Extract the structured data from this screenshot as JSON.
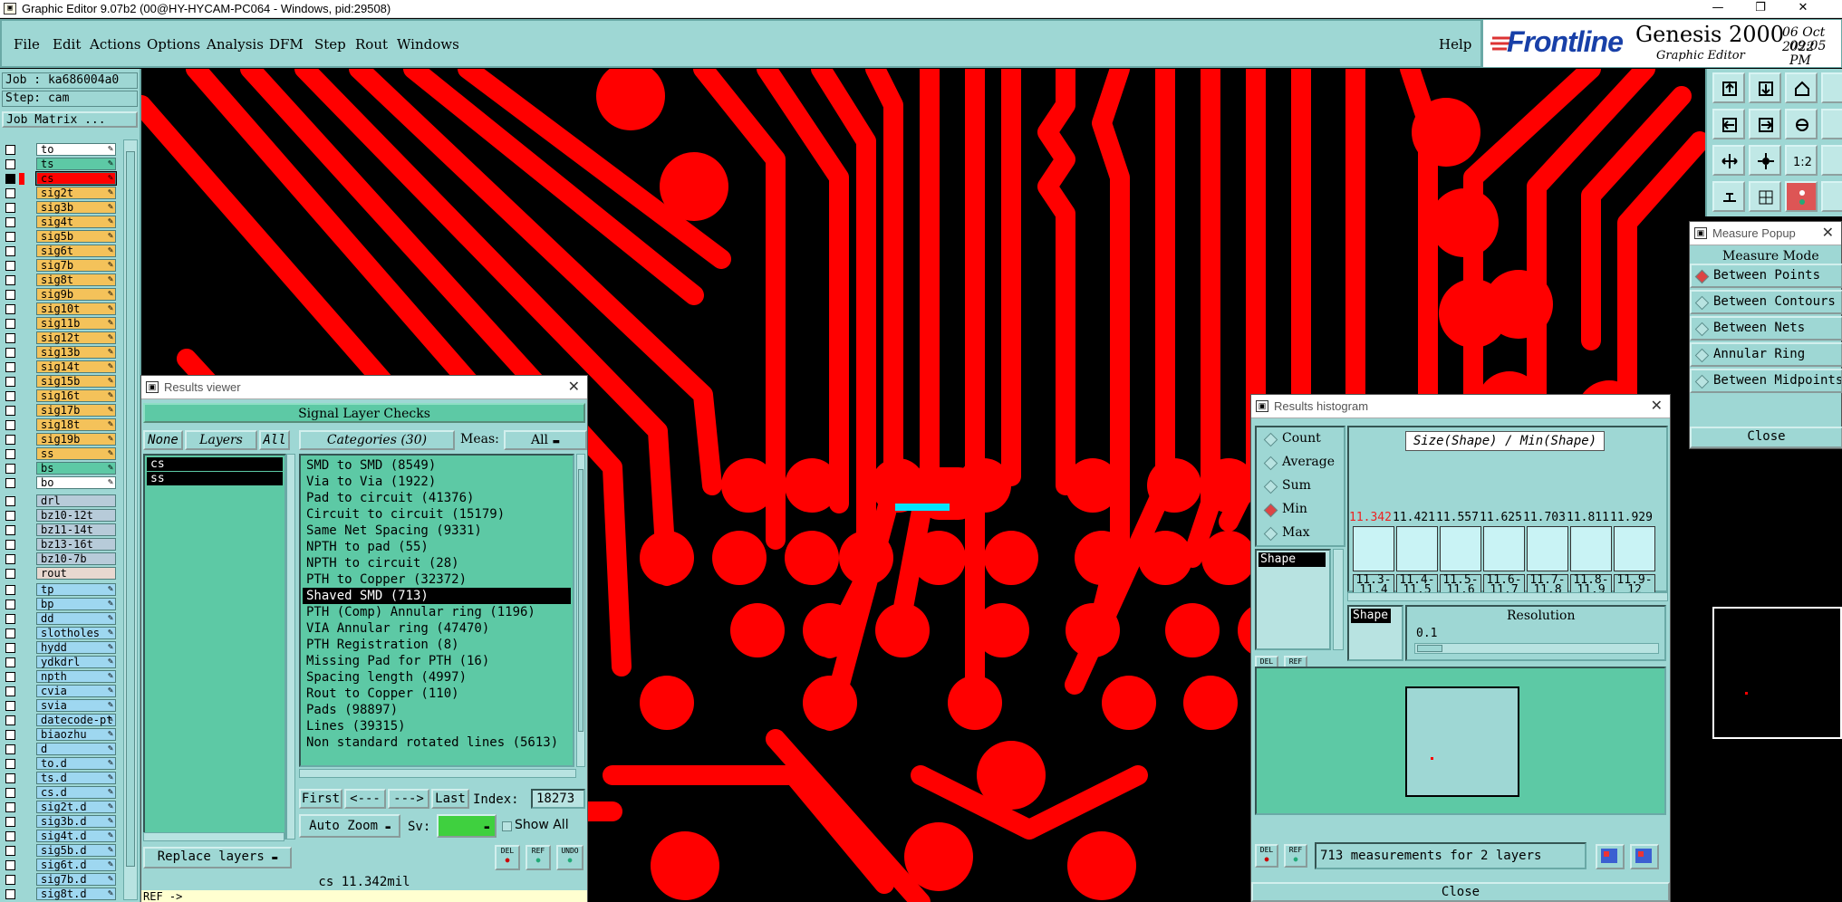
{
  "window": {
    "title": "Graphic Editor 9.07b2 (00@HY-HYCAM-PC064 - Windows, pid:29508)",
    "controls": [
      "—",
      "❐",
      "✕"
    ]
  },
  "menu": {
    "items": [
      "File",
      "Edit",
      "Actions",
      "Options",
      "Analysis",
      "DFM",
      "Step",
      "Rout",
      "Windows"
    ],
    "help": "Help"
  },
  "brand": {
    "logo": "Frontline",
    "product": "Genesis 2000",
    "subtitle": "Graphic Editor",
    "date": "06 Oct 2022",
    "time": "09:05 PM"
  },
  "left": {
    "job": "Job : ka686004a0",
    "step": "Step: cam",
    "job_matrix": "Job Matrix ...",
    "layers_top": [
      {
        "name": "to",
        "color": "#ffffff",
        "flag": ""
      },
      {
        "name": "ts",
        "color": "#5dc9a5",
        "flag": ""
      },
      {
        "name": "cs",
        "color": "#ff0000",
        "flag": "#ff0000",
        "checked": true
      },
      {
        "name": "sig2t",
        "color": "#f4c25a",
        "flag": ""
      },
      {
        "name": "sig3b",
        "color": "#f4c25a",
        "flag": ""
      },
      {
        "name": "sig4t",
        "color": "#f4c25a",
        "flag": ""
      },
      {
        "name": "sig5b",
        "color": "#f4c25a",
        "flag": ""
      },
      {
        "name": "sig6t",
        "color": "#f4c25a",
        "flag": ""
      },
      {
        "name": "sig7b",
        "color": "#f4c25a",
        "flag": ""
      },
      {
        "name": "sig8t",
        "color": "#f4c25a",
        "flag": ""
      },
      {
        "name": "sig9b",
        "color": "#f4c25a",
        "flag": ""
      },
      {
        "name": "sig10t",
        "color": "#f4c25a",
        "flag": ""
      },
      {
        "name": "sig11b",
        "color": "#f4c25a",
        "flag": ""
      },
      {
        "name": "sig12t",
        "color": "#f4c25a",
        "flag": ""
      },
      {
        "name": "sig13b",
        "color": "#f4c25a",
        "flag": ""
      },
      {
        "name": "sig14t",
        "color": "#f4c25a",
        "flag": ""
      },
      {
        "name": "sig15b",
        "color": "#f4c25a",
        "flag": ""
      },
      {
        "name": "sig16t",
        "color": "#f4c25a",
        "flag": ""
      },
      {
        "name": "sig17b",
        "color": "#f4c25a",
        "flag": ""
      },
      {
        "name": "sig18t",
        "color": "#f4c25a",
        "flag": ""
      },
      {
        "name": "sig19b",
        "color": "#f4c25a",
        "flag": ""
      },
      {
        "name": "ss",
        "color": "#f4c25a",
        "flag": ""
      },
      {
        "name": "bs",
        "color": "#5dc9a5",
        "flag": ""
      },
      {
        "name": "bo",
        "color": "#ffffff",
        "flag": ""
      }
    ],
    "layers_drill": [
      {
        "name": "drl",
        "color": "#b7cbd9"
      },
      {
        "name": "bz10-12t",
        "color": "#b7cbd9"
      },
      {
        "name": "bz11-14t",
        "color": "#b7cbd9"
      },
      {
        "name": "bz13-16t",
        "color": "#b7cbd9"
      },
      {
        "name": "bz10-7b",
        "color": "#b7cbd9"
      },
      {
        "name": "rout",
        "color": "#e8d8d0"
      }
    ],
    "layers_misc": [
      {
        "name": "tp",
        "color": "#9ed7f0"
      },
      {
        "name": "bp",
        "color": "#9ed7f0"
      },
      {
        "name": "dd",
        "color": "#9ed7f0"
      },
      {
        "name": "slotholes",
        "color": "#9ed7f0"
      },
      {
        "name": "hydd",
        "color": "#9ed7f0"
      },
      {
        "name": "ydkdrl",
        "color": "#9ed7f0"
      },
      {
        "name": "npth",
        "color": "#9ed7f0"
      },
      {
        "name": "cvia",
        "color": "#9ed7f0"
      },
      {
        "name": "svia",
        "color": "#9ed7f0"
      },
      {
        "name": "datecode-pt",
        "color": "#9ed7f0"
      },
      {
        "name": "biaozhu",
        "color": "#9ed7f0"
      },
      {
        "name": "d",
        "color": "#9ed7f0"
      },
      {
        "name": "to.d",
        "color": "#9ed7f0"
      },
      {
        "name": "ts.d",
        "color": "#9ed7f0"
      },
      {
        "name": "cs.d",
        "color": "#9ed7f0"
      },
      {
        "name": "sig2t.d",
        "color": "#9ed7f0"
      },
      {
        "name": "sig3b.d",
        "color": "#9ed7f0"
      },
      {
        "name": "sig4t.d",
        "color": "#9ed7f0"
      },
      {
        "name": "sig5b.d",
        "color": "#9ed7f0"
      },
      {
        "name": "sig6t.d",
        "color": "#9ed7f0"
      },
      {
        "name": "sig7b.d",
        "color": "#9ed7f0"
      },
      {
        "name": "sig8t.d",
        "color": "#9ed7f0"
      }
    ]
  },
  "results_viewer": {
    "title": "Results viewer",
    "header": "Signal Layer Checks",
    "none": "None",
    "layers": "Layers",
    "all": "All",
    "categories": "Categories (30)",
    "meas_label": "Meas:",
    "meas_value": "All",
    "layer_list": [
      "cs",
      "ss"
    ],
    "items": [
      "SMD to SMD (8549)",
      "Via to Via (1922)",
      "Pad to circuit (41376)",
      "Circuit to circuit (15179)",
      "Same Net Spacing (9331)",
      "NPTH to pad (55)",
      "NPTH to circuit (28)",
      "PTH to Copper (32372)",
      "Shaved SMD (713)",
      "PTH (Comp) Annular ring (1196)",
      "VIA Annular ring (47470)",
      "PTH Registration (8)",
      "Missing Pad for PTH (16)",
      "Spacing length (4997)",
      "Rout to Copper (110)",
      "Pads (98897)",
      "Lines (39315)",
      "Non standard rotated lines (5613)"
    ],
    "selected_index": 8,
    "nav": {
      "first": "First",
      "prev": "<---",
      "next": "--->",
      "last": "Last",
      "index_label": "Index:",
      "index_value": "18273"
    },
    "auto_zoom": "Auto Zoom",
    "sv_label": "Sv:",
    "show_all": "Show All",
    "replace_layers": "Replace layers",
    "small_buttons": [
      "DEL",
      "REF",
      "UNDO"
    ],
    "status": "cs 11.342mil",
    "prompt": "REF ->"
  },
  "histogram": {
    "title": "Results histogram",
    "modes": [
      "Count",
      "Average",
      "Sum",
      "Min",
      "Max"
    ],
    "selected_mode": "Min",
    "heading": "Size(Shape) / Min(Shape)",
    "values": [
      "11.342",
      "11.421",
      "11.557",
      "11.625",
      "11.703",
      "11.811",
      "11.929"
    ],
    "ranges": [
      [
        "11.3-",
        "11.4"
      ],
      [
        "11.4-",
        "11.5"
      ],
      [
        "11.5-",
        "11.6"
      ],
      [
        "11.6-",
        "11.7"
      ],
      [
        "11.7-",
        "11.8"
      ],
      [
        "11.8-",
        "11.9"
      ],
      [
        "11.9-",
        "12"
      ]
    ],
    "shape_item": "Shape",
    "shape_label": "Shape",
    "resolution_label": "Resolution",
    "resolution_value": "0.1",
    "small_buttons": [
      "DEL",
      "REF"
    ],
    "status": "713 measurements for 2 layers",
    "close": "Close"
  },
  "measure": {
    "title": "Measure Popup",
    "mode_label": "Measure Mode",
    "options": [
      "Between Points",
      "Between Contours",
      "Between Nets",
      "Annular Ring",
      "Between Midpoints"
    ],
    "selected": "Between Points",
    "close": "Close"
  },
  "colors": {
    "panel": "#9ed7d4",
    "teal": "#5dc9a5",
    "copper": "#ff0000",
    "board": "#000000",
    "highlight": "#00e5ff"
  }
}
